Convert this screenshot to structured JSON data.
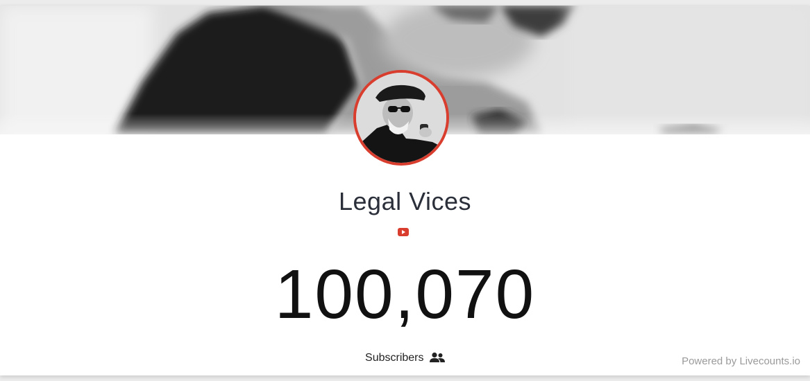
{
  "channel": {
    "name": "Legal Vices",
    "platform_icon": "youtube-icon",
    "avatar_icon": "channel-avatar"
  },
  "counter": {
    "value": "100,070",
    "label": "Subscribers",
    "label_icon": "users-icon"
  },
  "footer": {
    "powered_by": "Powered by Livecounts.io"
  },
  "colors": {
    "accent": "#d93d2e",
    "text": "#2a2f3a",
    "muted": "#9a9a9a"
  }
}
